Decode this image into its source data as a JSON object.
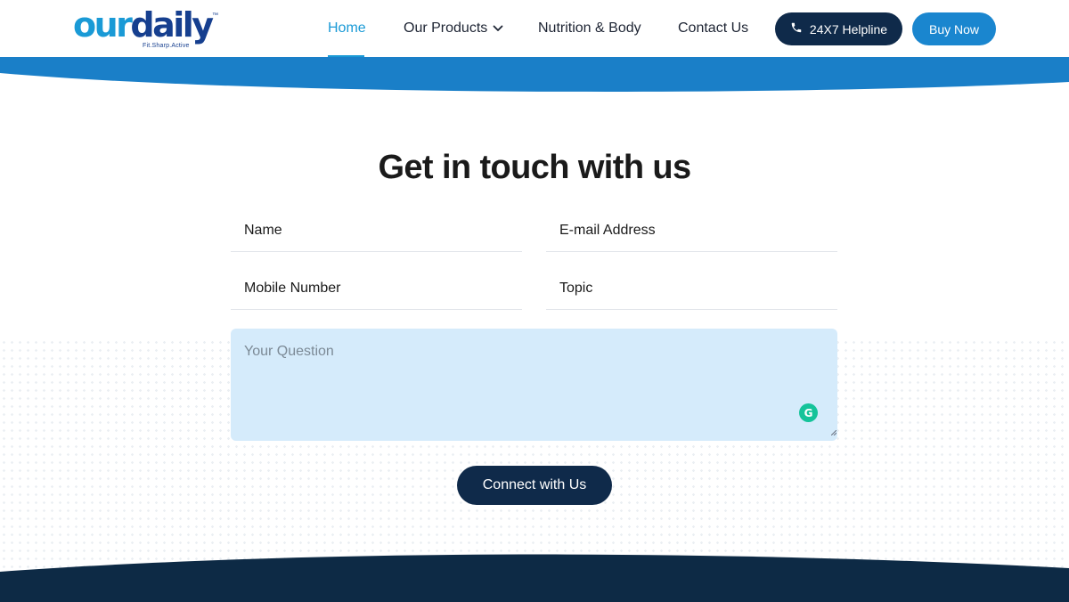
{
  "brand": {
    "logo_part1": "our",
    "logo_part2": "daily",
    "tagline": "Fit.Sharp.Active",
    "trademark": "™",
    "colors": {
      "primary_blue": "#1a86cf",
      "light_blue": "#1a9ad6",
      "navy": "#0f2a4a",
      "dark_footer": "#0d2a45"
    }
  },
  "nav": {
    "items": [
      {
        "label": "Home",
        "active": true
      },
      {
        "label": "Our Products",
        "has_dropdown": true,
        "icon": "chevron-down-icon"
      },
      {
        "label": "Nutrition & Body"
      },
      {
        "label": "Contact Us"
      }
    ],
    "helpline": {
      "label": "24X7 Helpline",
      "icon": "phone-icon"
    },
    "buy": {
      "label": "Buy Now"
    }
  },
  "contact_form": {
    "title": "Get in touch with us",
    "fields": {
      "name": {
        "placeholder": "Name"
      },
      "email": {
        "placeholder": "E-mail Address"
      },
      "mobile": {
        "placeholder": "Mobile Number"
      },
      "topic": {
        "placeholder": "Topic"
      },
      "question": {
        "placeholder": "Your Question"
      }
    },
    "grammarly_badge": "G",
    "submit_label": "Connect with Us"
  }
}
